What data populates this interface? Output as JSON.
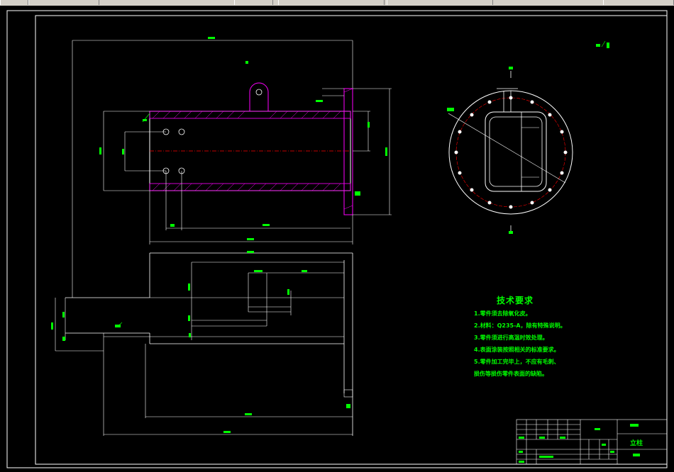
{
  "app": {
    "toolbar_segments": 6
  },
  "drawing": {
    "colors": {
      "background": "#000000",
      "outline": "#ffffff",
      "dimension": "#00ff00",
      "centerline": "#ff0000",
      "hatch": "#ff00ff"
    }
  },
  "tech_requirements": {
    "title": "技术要求",
    "items": [
      "1.零件须去除氧化皮。",
      "2.材料：Q235-A，除有特殊说明。",
      "3.零件须进行高温时效处理。",
      "4.表面涂装按照相关的标准要求。",
      "5.零件加工完毕上，不应有毛刺、",
      "损伤等损伤零件表面的缺陷。"
    ]
  },
  "title_block": {
    "part_name": "立柱"
  }
}
